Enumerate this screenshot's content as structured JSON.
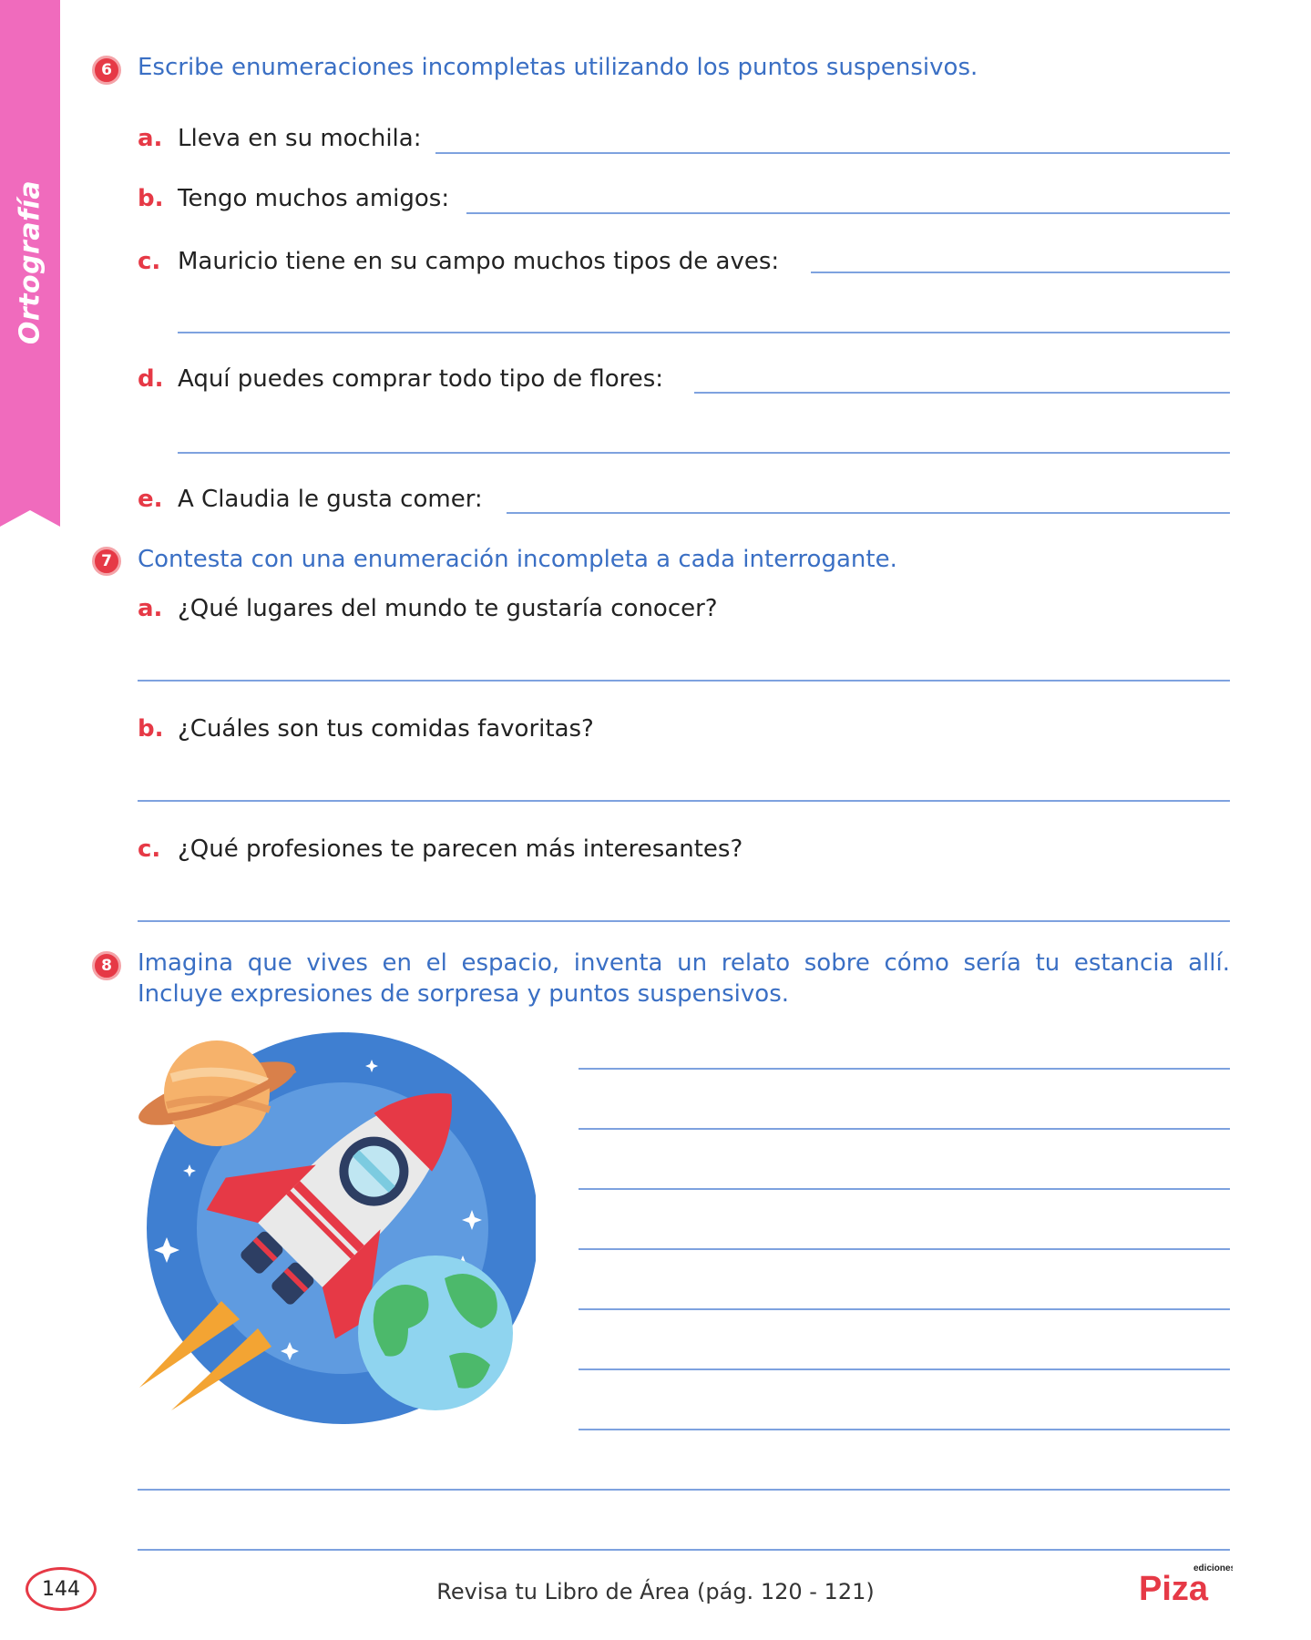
{
  "sidebar": {
    "label": "Ortografía",
    "color": "#f06bbd"
  },
  "exercise6": {
    "number": "6",
    "instruction": "Escribe enumeraciones incompletas utilizando los puntos suspensivos.",
    "items": [
      {
        "letter": "a.",
        "text": "Lleva en su mochila:"
      },
      {
        "letter": "b.",
        "text": "Tengo muchos amigos:"
      },
      {
        "letter": "c.",
        "text": "Mauricio tiene en su campo muchos tipos de aves:"
      },
      {
        "letter": "d.",
        "text": "Aquí puedes comprar todo tipo de flores:"
      },
      {
        "letter": "e.",
        "text": "A Claudia le gusta comer:"
      }
    ]
  },
  "exercise7": {
    "number": "7",
    "instruction": "Contesta con una enumeración incompleta a cada interrogante.",
    "items": [
      {
        "letter": "a.",
        "text": "¿Qué lugares del mundo te gustaría conocer?"
      },
      {
        "letter": "b.",
        "text": "¿Cuáles son tus comidas favoritas?"
      },
      {
        "letter": "c.",
        "text": "¿Qué profesiones te parecen más interesantes?"
      }
    ]
  },
  "exercise8": {
    "number": "8",
    "instruction_line1": "Imagina que vives en el espacio, inventa un relato sobre cómo sería tu estancia allí.",
    "instruction_line2": "Incluye expresiones de sorpresa y puntos suspensivos.",
    "illustration": "rocket-space-illustration"
  },
  "footer": {
    "page_number": "144",
    "reference": "Revisa tu Libro de Área (pág. 120 - 121)",
    "logo_small": "ediciones",
    "logo_main": "Piza"
  },
  "colors": {
    "accent_red": "#e63946",
    "instruction_blue": "#3a6fc4",
    "line_blue": "#7ea2df"
  }
}
